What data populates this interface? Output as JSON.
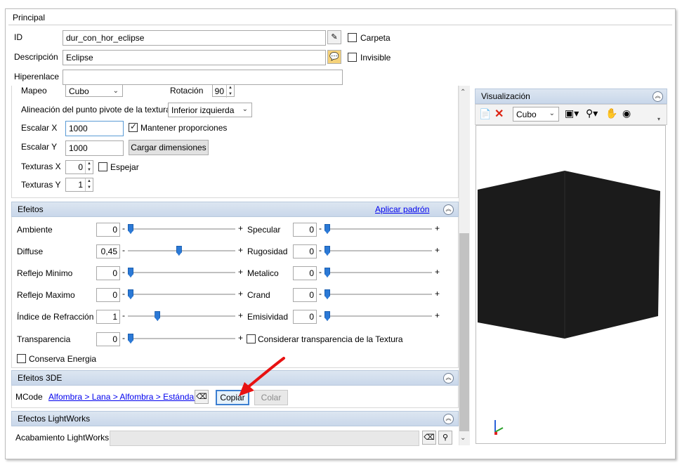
{
  "principal": {
    "title": "Principal",
    "id_label": "ID",
    "id_value": "dur_con_hor_eclipse",
    "desc_label": "Descripción",
    "desc_value": "Eclipse",
    "link_label": "Hiperenlace",
    "link_value": "",
    "carpeta_label": "Carpeta",
    "invisible_label": "Invisible"
  },
  "mapping": {
    "mapeo_label": "Mapeo",
    "mapeo_value": "Cubo",
    "rotacion_label": "Rotación",
    "rotacion_value": "90",
    "pivot_label": "Alineación del punto pivote de la textura",
    "pivot_value": "Inferior izquierda",
    "escalar_x_label": "Escalar X",
    "escalar_x_value": "1000",
    "mantener_label": "Mantener proporciones",
    "escalar_y_label": "Escalar Y",
    "escalar_y_value": "1000",
    "cargar_label": "Cargar dimensiones",
    "texturas_x_label": "Texturas X",
    "texturas_x_value": "0",
    "espejar_label": "Espejar",
    "texturas_y_label": "Texturas Y",
    "texturas_y_value": "1"
  },
  "efeitos": {
    "title": "Efeitos",
    "aplicar_label": "Aplicar padrón",
    "left": [
      {
        "label": "Ambiente",
        "value": "0",
        "level": 0
      },
      {
        "label": "Diffuse",
        "value": "0,45",
        "level": 0.45
      },
      {
        "label": "Reflejo Minimo",
        "value": "0",
        "level": 0
      },
      {
        "label": "Reflejo Maximo",
        "value": "0",
        "level": 0
      },
      {
        "label": "Índice de Refracción",
        "value": "1",
        "level": 0.25
      },
      {
        "label": "Transparencia",
        "value": "0",
        "level": 0
      }
    ],
    "right": [
      {
        "label": "Specular",
        "value": "0",
        "level": 0
      },
      {
        "label": "Rugosidad",
        "value": "0",
        "level": 0
      },
      {
        "label": "Metalico",
        "value": "0",
        "level": 0
      },
      {
        "label": "Crand",
        "value": "0",
        "level": 0
      },
      {
        "label": "Emisividad",
        "value": "0",
        "level": 0
      }
    ],
    "minus": "-",
    "plus": "+",
    "considerar_label": "Considerar transparencia de la Textura",
    "conserva_label": "Conserva Energia"
  },
  "efeitos3de": {
    "title": "Efeitos 3DE",
    "mcode_label": "MCode",
    "mcode_link": "Alfombra > Lana > Alfombra > Estándar",
    "copiar_label": "Copiar",
    "colar_label": "Colar"
  },
  "lightworks": {
    "title": "Efectos LightWorks",
    "acabamento_label": "Acabamiento LightWorks",
    "acabamento_value": ""
  },
  "visualizacion": {
    "title": "Visualización",
    "shape_value": "Cubo"
  },
  "colors": {
    "accent": "#2b79d6",
    "arrow": "#e81212",
    "cube": "#1b1b1b"
  }
}
